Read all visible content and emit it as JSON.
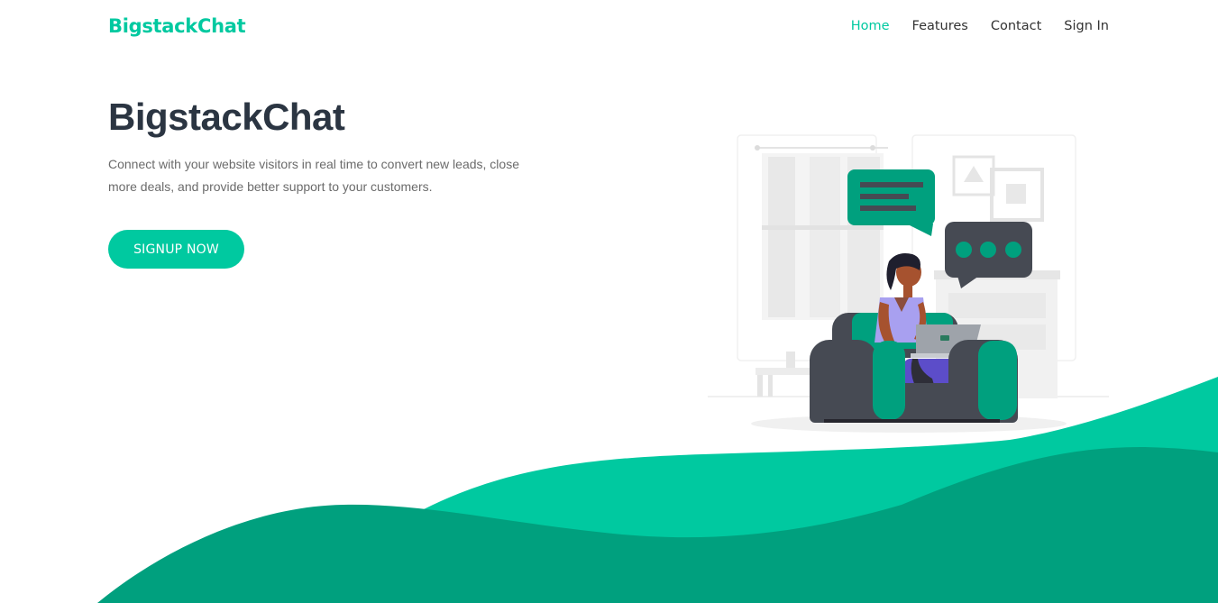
{
  "nav": {
    "brand": "BigstackChat",
    "links": [
      {
        "label": "Home",
        "active": true
      },
      {
        "label": "Features",
        "active": false
      },
      {
        "label": "Contact",
        "active": false
      },
      {
        "label": "Sign In",
        "active": false
      }
    ]
  },
  "hero": {
    "title": "BigstackChat",
    "description": "Connect with your website visitors in real time to convert new leads, close more deals, and provide better support to your customers.",
    "cta_label": "SIGNUP NOW"
  },
  "colors": {
    "accent": "#00c9a0",
    "accent_dark": "#00a07e",
    "title_dark": "#2b3542",
    "chat_bubble_dark": "#464a53"
  },
  "illustration": {
    "icon": "woman-on-sofa-with-laptop-chat-illustration"
  }
}
